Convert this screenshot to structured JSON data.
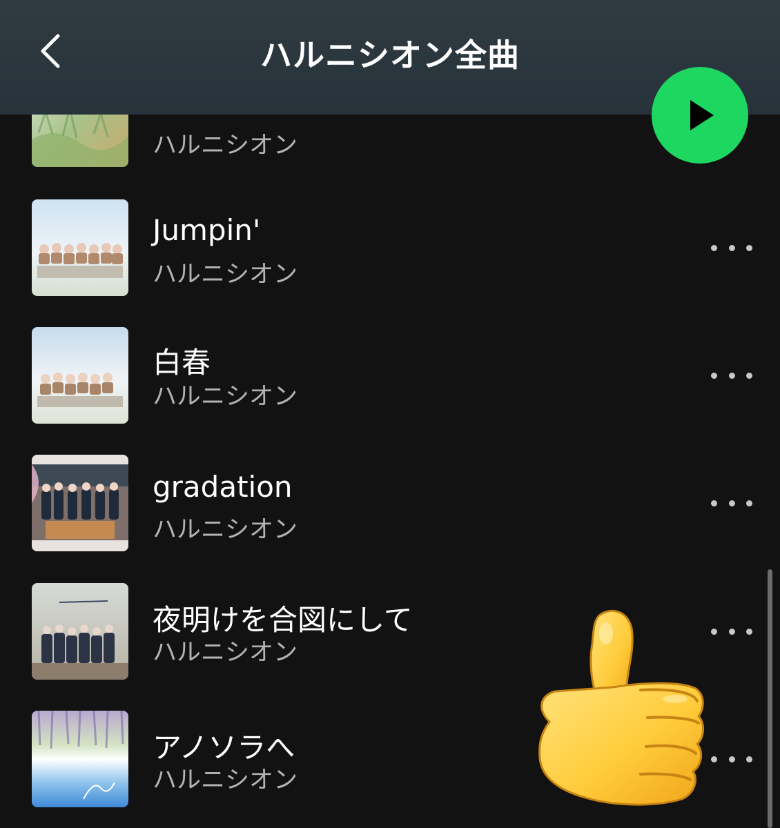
{
  "header": {
    "title": "ハルニシオン全曲"
  },
  "tracks": [
    {
      "title": "",
      "artist": "ハルニシオン"
    },
    {
      "title": "Jumpin'",
      "artist": "ハルニシオン"
    },
    {
      "title": "白春",
      "artist": "ハルニシオン"
    },
    {
      "title": "gradation",
      "artist": "ハルニシオン"
    },
    {
      "title": "夜明けを合図にして",
      "artist": "ハルニシオン"
    },
    {
      "title": "アノソラへ",
      "artist": "ハルニシオン"
    }
  ],
  "icons": {
    "back": "chevron-left-icon",
    "play": "play-icon",
    "more": "more-horizontal-icon",
    "overlay": "thumbs-up-emoji"
  },
  "colors": {
    "background": "#121212",
    "header": "#2d3a40",
    "accent": "#1ed760",
    "primary_text": "#ffffff",
    "secondary_text": "#b3b3b3"
  }
}
